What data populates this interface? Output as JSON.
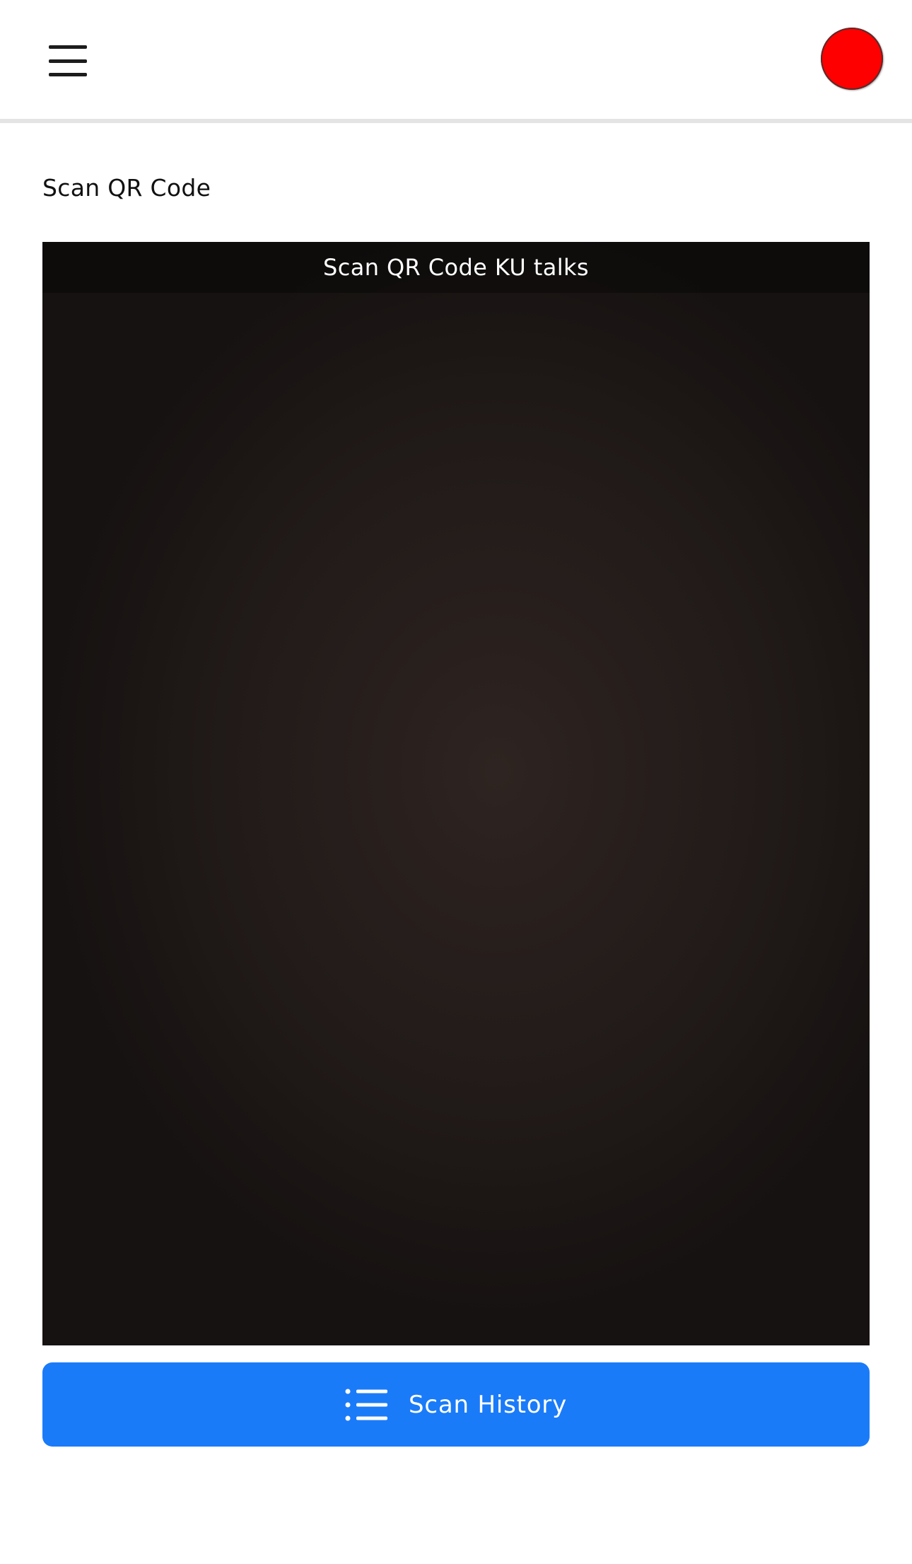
{
  "header": {
    "menu_icon": "hamburger-menu-icon",
    "avatar_color": "#ff0000"
  },
  "page": {
    "title": "Scan QR Code"
  },
  "scanner": {
    "title": "Scan QR Code KU talks"
  },
  "history_button": {
    "label": "Scan History",
    "icon": "list-icon",
    "color": "#1a7bf9"
  }
}
